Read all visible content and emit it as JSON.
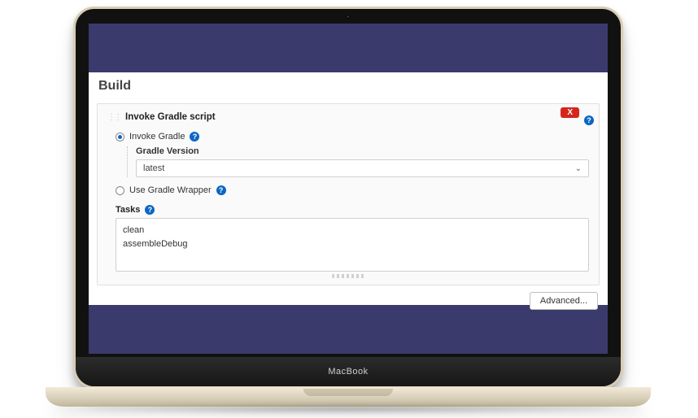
{
  "device": {
    "brand": "MacBook"
  },
  "section": {
    "title": "Build"
  },
  "panel": {
    "title": "Invoke Gradle script",
    "close_label": "X",
    "options": {
      "invoke_gradle": {
        "label": "Invoke Gradle",
        "checked": true
      },
      "use_wrapper": {
        "label": "Use Gradle Wrapper",
        "checked": false
      }
    },
    "gradle_version": {
      "label": "Gradle Version",
      "value": "latest"
    },
    "tasks": {
      "label": "Tasks",
      "value": "clean\nassembleDebug"
    },
    "advanced_button": "Advanced..."
  },
  "icons": {
    "help_glyph": "?",
    "handle_glyph": "⋮⋮",
    "chevron_down": "⌄"
  }
}
